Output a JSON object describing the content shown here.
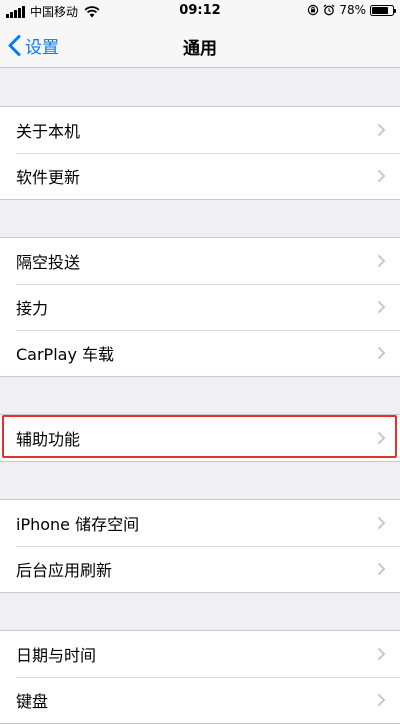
{
  "status_bar": {
    "carrier": "中国移动",
    "time": "09:12",
    "battery": "78%",
    "battery_level": 0.78
  },
  "nav": {
    "back_label": "设置",
    "title": "通用"
  },
  "groups": [
    {
      "items": [
        {
          "label": "关于本机"
        },
        {
          "label": "软件更新"
        }
      ]
    },
    {
      "items": [
        {
          "label": "隔空投送"
        },
        {
          "label": "接力"
        },
        {
          "label": "CarPlay 车载"
        }
      ]
    },
    {
      "items": [
        {
          "label": "辅助功能"
        }
      ]
    },
    {
      "items": [
        {
          "label": "iPhone 储存空间"
        },
        {
          "label": "后台应用刷新"
        }
      ]
    },
    {
      "items": [
        {
          "label": "日期与时间"
        },
        {
          "label": "键盘"
        }
      ]
    }
  ],
  "colors": {
    "accent": "#007aff",
    "highlight": "#e8302b",
    "background": "#efeff4"
  }
}
